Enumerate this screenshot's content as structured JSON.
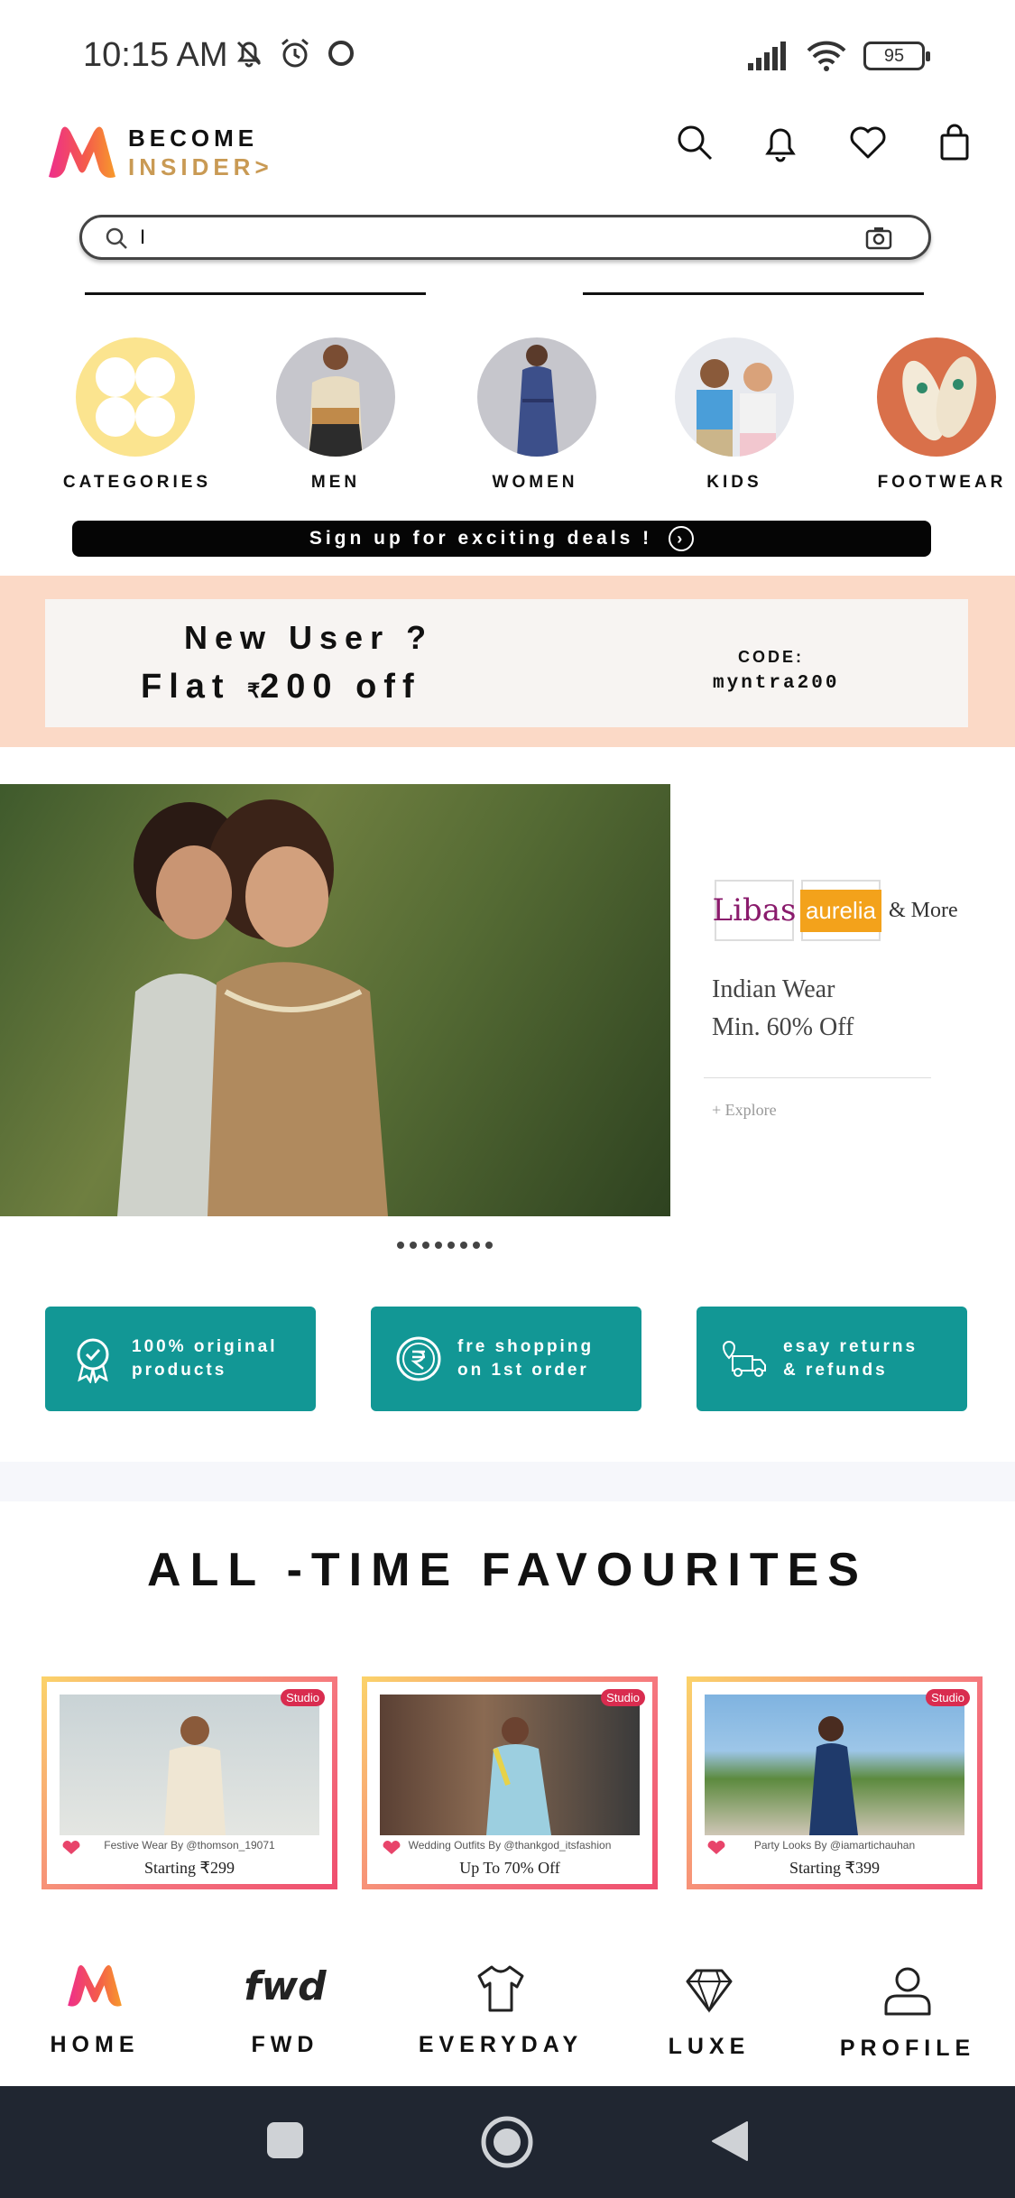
{
  "status_bar": {
    "time": "10:15 AM",
    "battery": "95",
    "icons": [
      "mute-bell-icon",
      "alarm-icon",
      "circle-icon",
      "signal-icon",
      "wifi-icon",
      "battery-icon"
    ]
  },
  "header": {
    "brand_line1": "BECOME",
    "brand_line2": "INSIDER",
    "brand_arrow": ">",
    "icons": [
      "search-icon",
      "bell-icon",
      "heart-icon",
      "bag-icon"
    ],
    "brand_gold": "#c99a54"
  },
  "search": {
    "value": "I",
    "placeholder": ""
  },
  "categories": [
    {
      "label": "CATEGORIES"
    },
    {
      "label": "MEN"
    },
    {
      "label": "WOMEN"
    },
    {
      "label": "KIDS"
    },
    {
      "label": "FOOTWEAR"
    }
  ],
  "signup": {
    "label": "Sign up for exciting deals !"
  },
  "promo": {
    "line1": "New User ?",
    "line2_prefix": "Flat",
    "currency": "₹",
    "line2_amount": "200 off",
    "code_label": "CODE:",
    "code_value": "myntra200",
    "band_color": "#fbd9c6"
  },
  "hero": {
    "brand1": "Libas",
    "brand2": "aurelia",
    "and_more": "& More",
    "title_line1": "Indian Wear",
    "title_line2": "Min. 60% Off",
    "explore": "+ Explore",
    "dots": 8
  },
  "features": [
    {
      "line1": "100% original",
      "line2": "products",
      "icon": "badge-check-icon"
    },
    {
      "line1": "fre shopping",
      "line2": "on 1st order",
      "icon": "rupee-coin-icon"
    },
    {
      "line1": "esay returns",
      "line2": "& refunds",
      "icon": "delivery-truck-icon"
    }
  ],
  "feature_color": "#129795",
  "favourites": {
    "title": "ALL -TIME FAVOURITES",
    "cards": [
      {
        "studio": "Studio",
        "caption": "Festive Wear By @thomson_19071",
        "price": "Starting ₹299"
      },
      {
        "studio": "Studio",
        "caption": "Wedding Outfits By @thankgod_itsfashion",
        "price": "Up To 70% Off"
      },
      {
        "studio": "Studio",
        "caption": "Party Looks By @iamartichauhan",
        "price": "Starting ₹399"
      }
    ]
  },
  "bottom_nav": [
    {
      "label": "HOME",
      "icon": "myntra-logo-icon"
    },
    {
      "label": "FWD",
      "icon": "fwd-logo-icon"
    },
    {
      "label": "EVERYDAY",
      "icon": "tshirt-icon"
    },
    {
      "label": "LUXE",
      "icon": "diamond-icon"
    },
    {
      "label": "PROFILE",
      "icon": "user-icon"
    }
  ],
  "system_nav": [
    "recents-button",
    "home-button",
    "back-button"
  ]
}
